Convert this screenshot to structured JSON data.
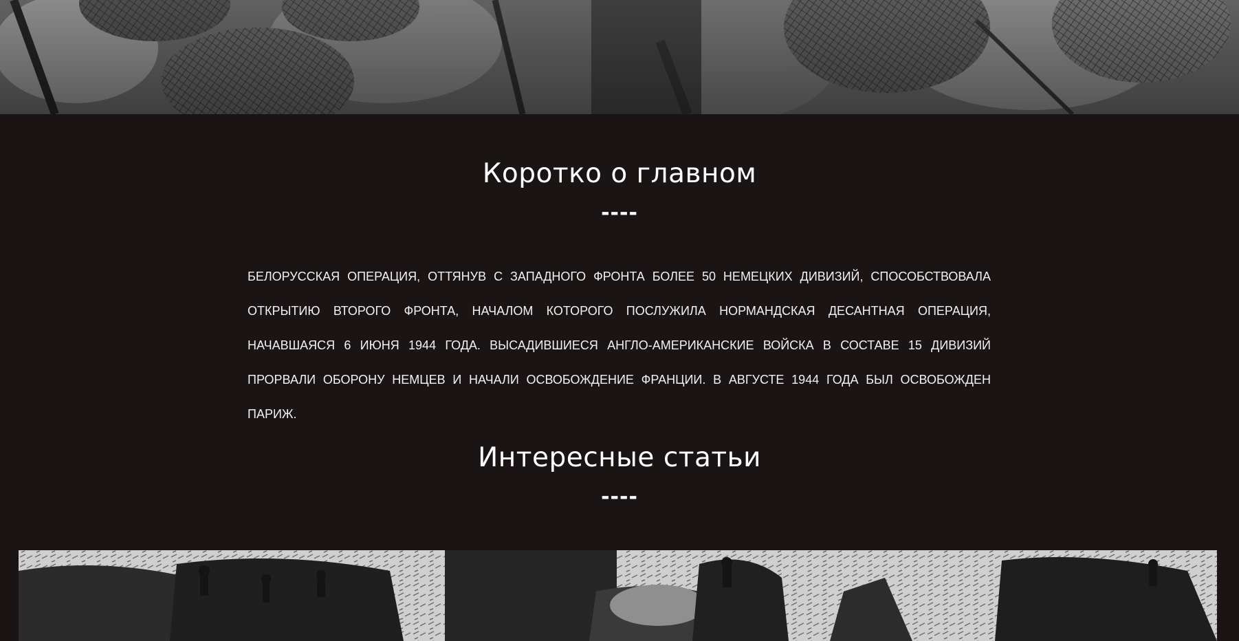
{
  "hero": {
    "image_name": "soldiers-in-landing-craft-photo"
  },
  "summary_section": {
    "title": "Коротко о главном",
    "divider": "----",
    "text": "Белорусская операция, оттянув с Западного фронта более 50 немецких дивизий, способствовала открытию второго фронта, началом которого послужила Нормандская десантная операция, начавшаяся 6 июня 1944 года. Высадившиеся англо-американские войска в составе 15 дивизий прорвали оборону немцев и начали освобождение Франции. В августе 1944 года был освобожден Париж."
  },
  "articles_section": {
    "title": "Интересные статьи",
    "divider": "----",
    "image_name": "beach-landing-photo"
  },
  "colors": {
    "page_background": "#1a1415",
    "text": "#ffffff"
  }
}
